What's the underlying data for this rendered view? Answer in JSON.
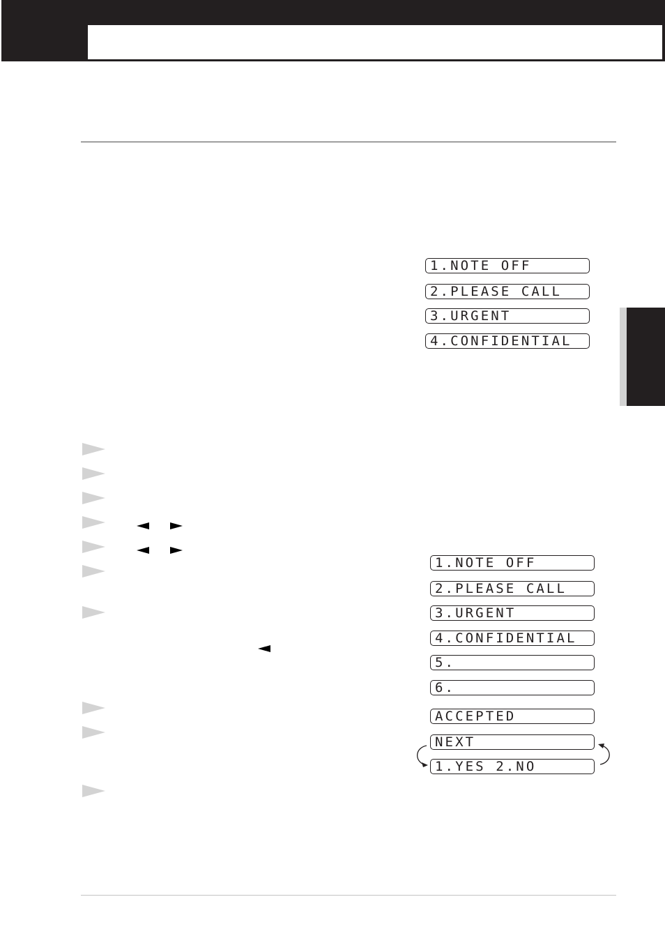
{
  "header": {
    "title": "",
    "section_tab": ""
  },
  "lcd_group_1": {
    "items": [
      "1.NOTE OFF",
      "2.PLEASE CALL",
      "3.URGENT",
      "4.CONFIDENTIAL"
    ]
  },
  "lcd_group_2": {
    "items": [
      "1.NOTE OFF",
      "2.PLEASE CALL",
      "3.URGENT",
      "4.CONFIDENTIAL",
      "5.",
      "6."
    ],
    "accepted": "ACCEPTED",
    "next": "NEXT",
    "yes_no": "1.YES 2.NO"
  },
  "steps": {
    "count": 10
  },
  "icons": {
    "step_marker": "triangle-right-gray",
    "nav_left": "triangle-left-black",
    "nav_right": "triangle-right-black",
    "cycle": "cycle-arrows"
  },
  "colors": {
    "ink": "#231f20",
    "marker": "#d3d3d3",
    "rule": "#4a4a4a"
  }
}
